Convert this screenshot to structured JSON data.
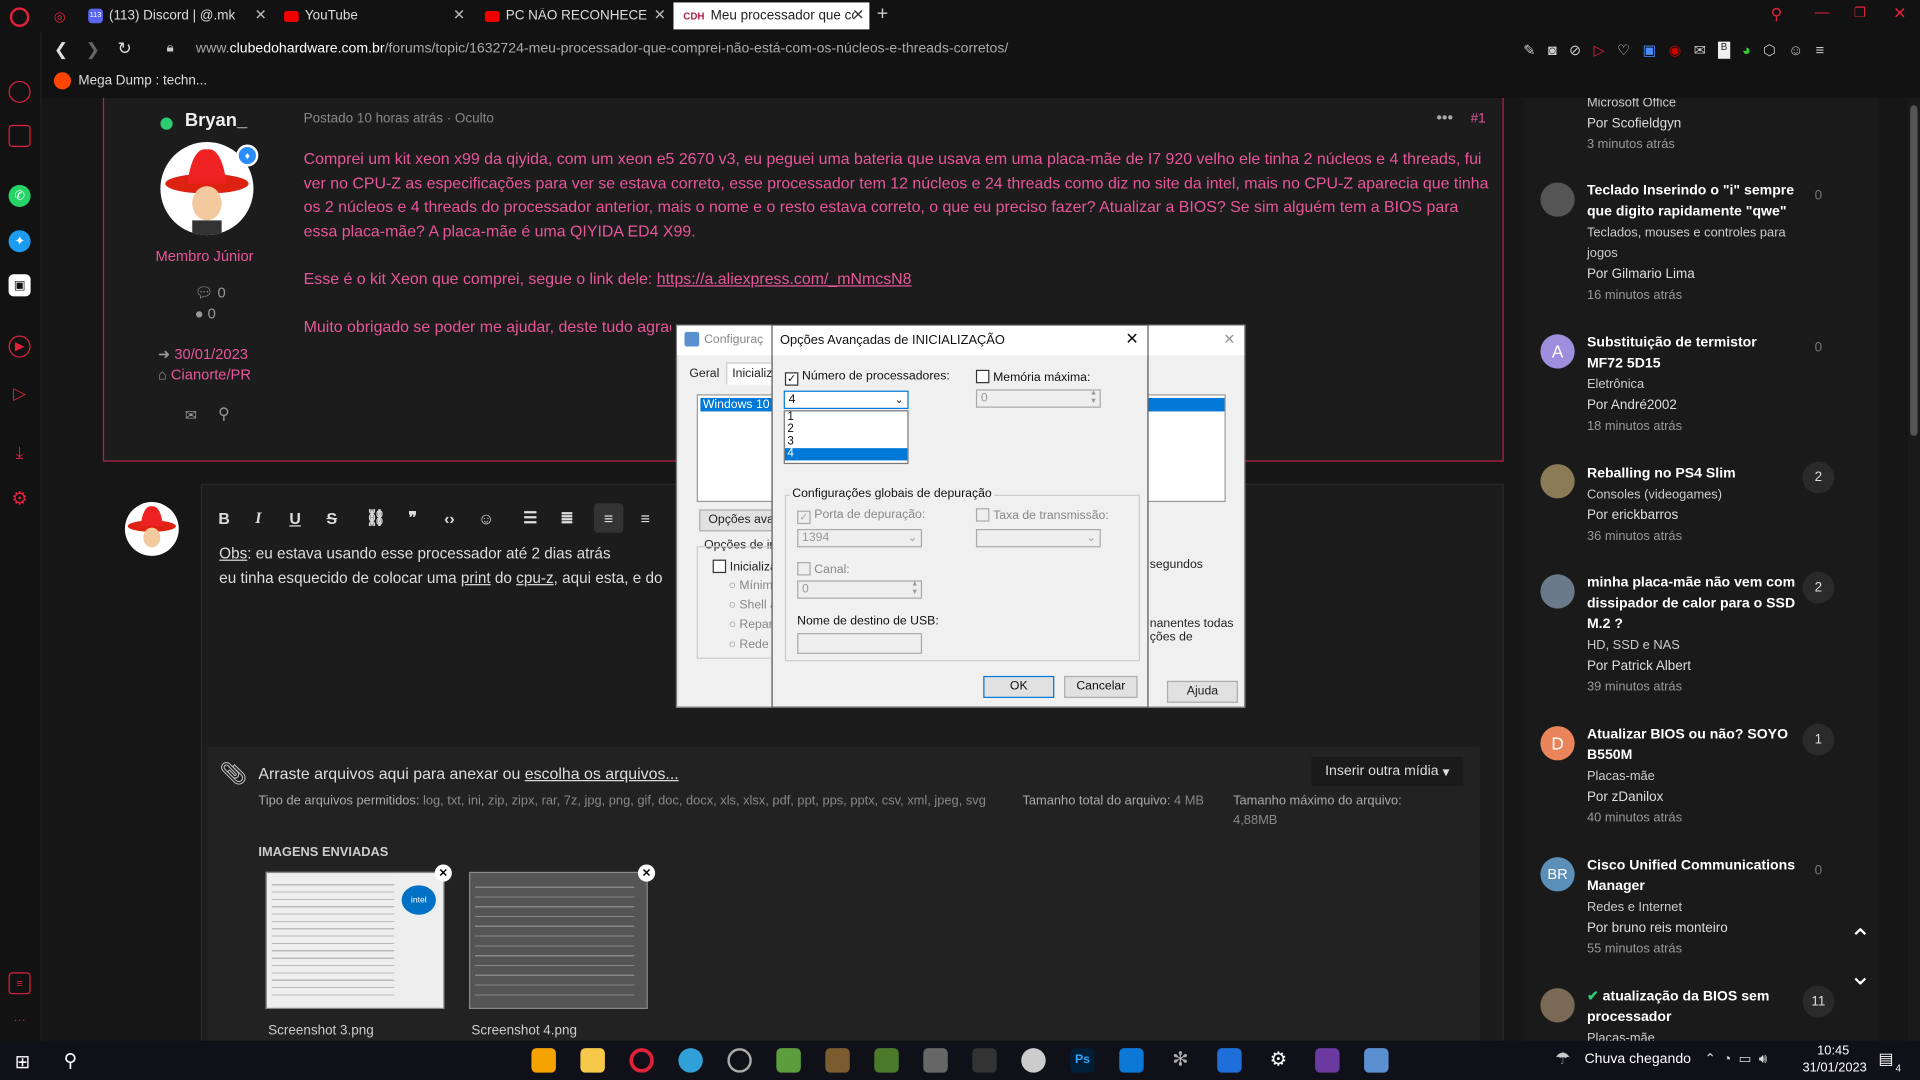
{
  "tabs": [
    {
      "label": "",
      "icon": "reddit-icon"
    },
    {
      "label": "(113) Discord | @.mk",
      "icon": "discord-icon",
      "badge": "113"
    },
    {
      "label": "YouTube",
      "icon": "youtube-icon"
    },
    {
      "label": "PC NÃO RECONHECE TODO",
      "icon": "youtube-icon"
    },
    {
      "label": "Meu processador que com",
      "icon": "cdh-icon"
    }
  ],
  "address": {
    "url_prefix": "www.",
    "url_domain": "clubedohardware.com.br",
    "url_path": "/forums/topic/1632724-meu-processador-que-comprei-não-está-com-os-núcleos-e-threads-corretos/"
  },
  "bookmark": {
    "label": "Mega Dump : techn..."
  },
  "post": {
    "author": "Bryan_",
    "meta": "Postado 10 horas atrás · Oculto",
    "number": "#1",
    "rank": "Membro Júnior",
    "stat_comments": "0",
    "stat_reputation": "0",
    "joined": "30/01/2023",
    "location": "Cianorte/PR",
    "paragraph1": "Comprei um kit xeon x99 da qiyida, com um xeon e5 2670 v3, eu peguei uma bateria que usava em uma placa-mãe de I7 920 velho ele tinha 2 núcleos e 4 threads, fui ver no CPU-Z as especificações para ver se estava correto, esse processador tem 12 núcleos e 24 threads como diz no site da intel, mais no CPU-Z aparecia que tinha os 2 núcleos e 4 threads do processador anterior, mais o nome e o resto estava correto, o que eu preciso fazer? Atualizar a BIOS? Se sim alguém tem a BIOS para essa placa-mãe? A placa-mãe é uma QIYIDA ED4 X99.",
    "paragraph2_text": "Esse é o kit Xeon que comprei, segue o link dele: ",
    "paragraph2_link": "https://a.aliexpress.com/_mNmcsN8",
    "paragraph3": "Muito obrigado se poder me ajudar, deste tudo agrad"
  },
  "editor": {
    "line1_prefix": "Obs",
    "line1_rest": ": eu estava usando esse processador até 2 dias atrás",
    "line2_a": "eu tinha esquecido de colocar uma ",
    "line2_b": "print",
    "line2_c": " do ",
    "line2_d": "cpu-z",
    "line2_e": ", aqui esta, e do",
    "attach_title_a": "Arraste arquivos aqui para anexar ou ",
    "attach_title_link": "escolha os arquivos...",
    "insert_media": "Inserir outra mídia",
    "allowed_label": "Tipo de arquivos permitidos:",
    "allowed_values": "log, txt, ini, zip, zipx, rar, 7z, jpg, png, gif, doc, docx, xls, xlsx, pdf, ppt, pps, pptx, csv, xml, jpeg, svg",
    "total_label": "Tamanho total do arquivo:",
    "total_value": "4 MB",
    "max_label": "Tamanho máximo do arquivo:",
    "max_value": "4,88MB",
    "uploaded_label": "IMAGENS ENVIADAS",
    "thumb1_caption": "Screenshot 3.png",
    "thumb2_caption": "Screenshot 4.png"
  },
  "sidebar": {
    "items": [
      {
        "title": "Microsoft Office",
        "by": "Por Scofieldgyn",
        "time": "3 minutos atrás",
        "count": ""
      },
      {
        "title": "Teclado Inserindo o \"i\" sempre que digito rapidamente \"qwe\"",
        "category": "Teclados, mouses e controles para jogos",
        "by": "Por Gilmario Lima",
        "time": "16 minutos atrás",
        "count": "0"
      },
      {
        "title": "Substituição de termistor MF72 5D15",
        "category": "Eletrônica",
        "by": "Por André2002",
        "time": "18 minutos atrás",
        "count": "0",
        "avatar_letter": "A"
      },
      {
        "title": "Reballing no PS4 Slim",
        "category": "Consoles (videogames)",
        "by": "Por erickbarros",
        "time": "36 minutos atrás",
        "count": "2"
      },
      {
        "title": "minha placa-mãe não vem com dissipador de calor para o SSD M.2 ?",
        "category": "HD, SSD e NAS",
        "by": "Por Patrick Albert",
        "time": "39 minutos atrás",
        "count": "2"
      },
      {
        "title": "Atualizar BIOS ou não? SOYO B550M",
        "category": "Placas-mãe",
        "by": "Por zDanilox",
        "time": "40 minutos atrás",
        "count": "1",
        "avatar_letter": "D"
      },
      {
        "title": "Cisco Unified Communications Manager",
        "category": "Redes e Internet",
        "by": "Por bruno reis monteiro",
        "time": "55 minutos atrás",
        "count": "0",
        "avatar_letter": "BR"
      },
      {
        "title": "atualização da BIOS sem processador",
        "category": "Placas-mãe",
        "by": "",
        "time": "",
        "count": "11"
      }
    ]
  },
  "dialog_back": {
    "title": "Configuraç",
    "tab1": "Geral",
    "tab2": "Inicializa",
    "list_item": "Windows 10 (C",
    "adv_button": "Opções avan",
    "boot_opts": "Opções de inic",
    "boot_cb": "Inicializaç",
    "radio1": "Mínim",
    "radio2": "Shell a",
    "radio3": "Repar",
    "radio4": "Rede",
    "seconds": "segundos",
    "perm": "nanentes todas",
    "perm2": "ções de",
    "help": "Ajuda"
  },
  "dialog": {
    "title": "Opções Avançadas de INICIALIZAÇÃO",
    "num_procs_label": "Número de processadores:",
    "num_procs_value": "4",
    "options": [
      "1",
      "2",
      "3",
      "4"
    ],
    "max_mem_label": "Memória máxima:",
    "max_mem_value": "0",
    "debug_group": "Configurações globais de depuração",
    "debug_port_label": "Porta de depuração:",
    "debug_port_value": "1394",
    "baud_label": "Taxa de transmissão:",
    "channel_label": "Canal:",
    "channel_value": "0",
    "usb_label": "Nome de destino de USB:",
    "ok": "OK",
    "cancel": "Cancelar"
  },
  "taskbar": {
    "weather": "Chuva chegando",
    "time": "10:45",
    "date": "31/01/2023",
    "notif_count": "4"
  },
  "colors": {
    "accent_pink": "#e8569a",
    "post_border": "#b5204a",
    "dialog_select": "#0078d7"
  }
}
